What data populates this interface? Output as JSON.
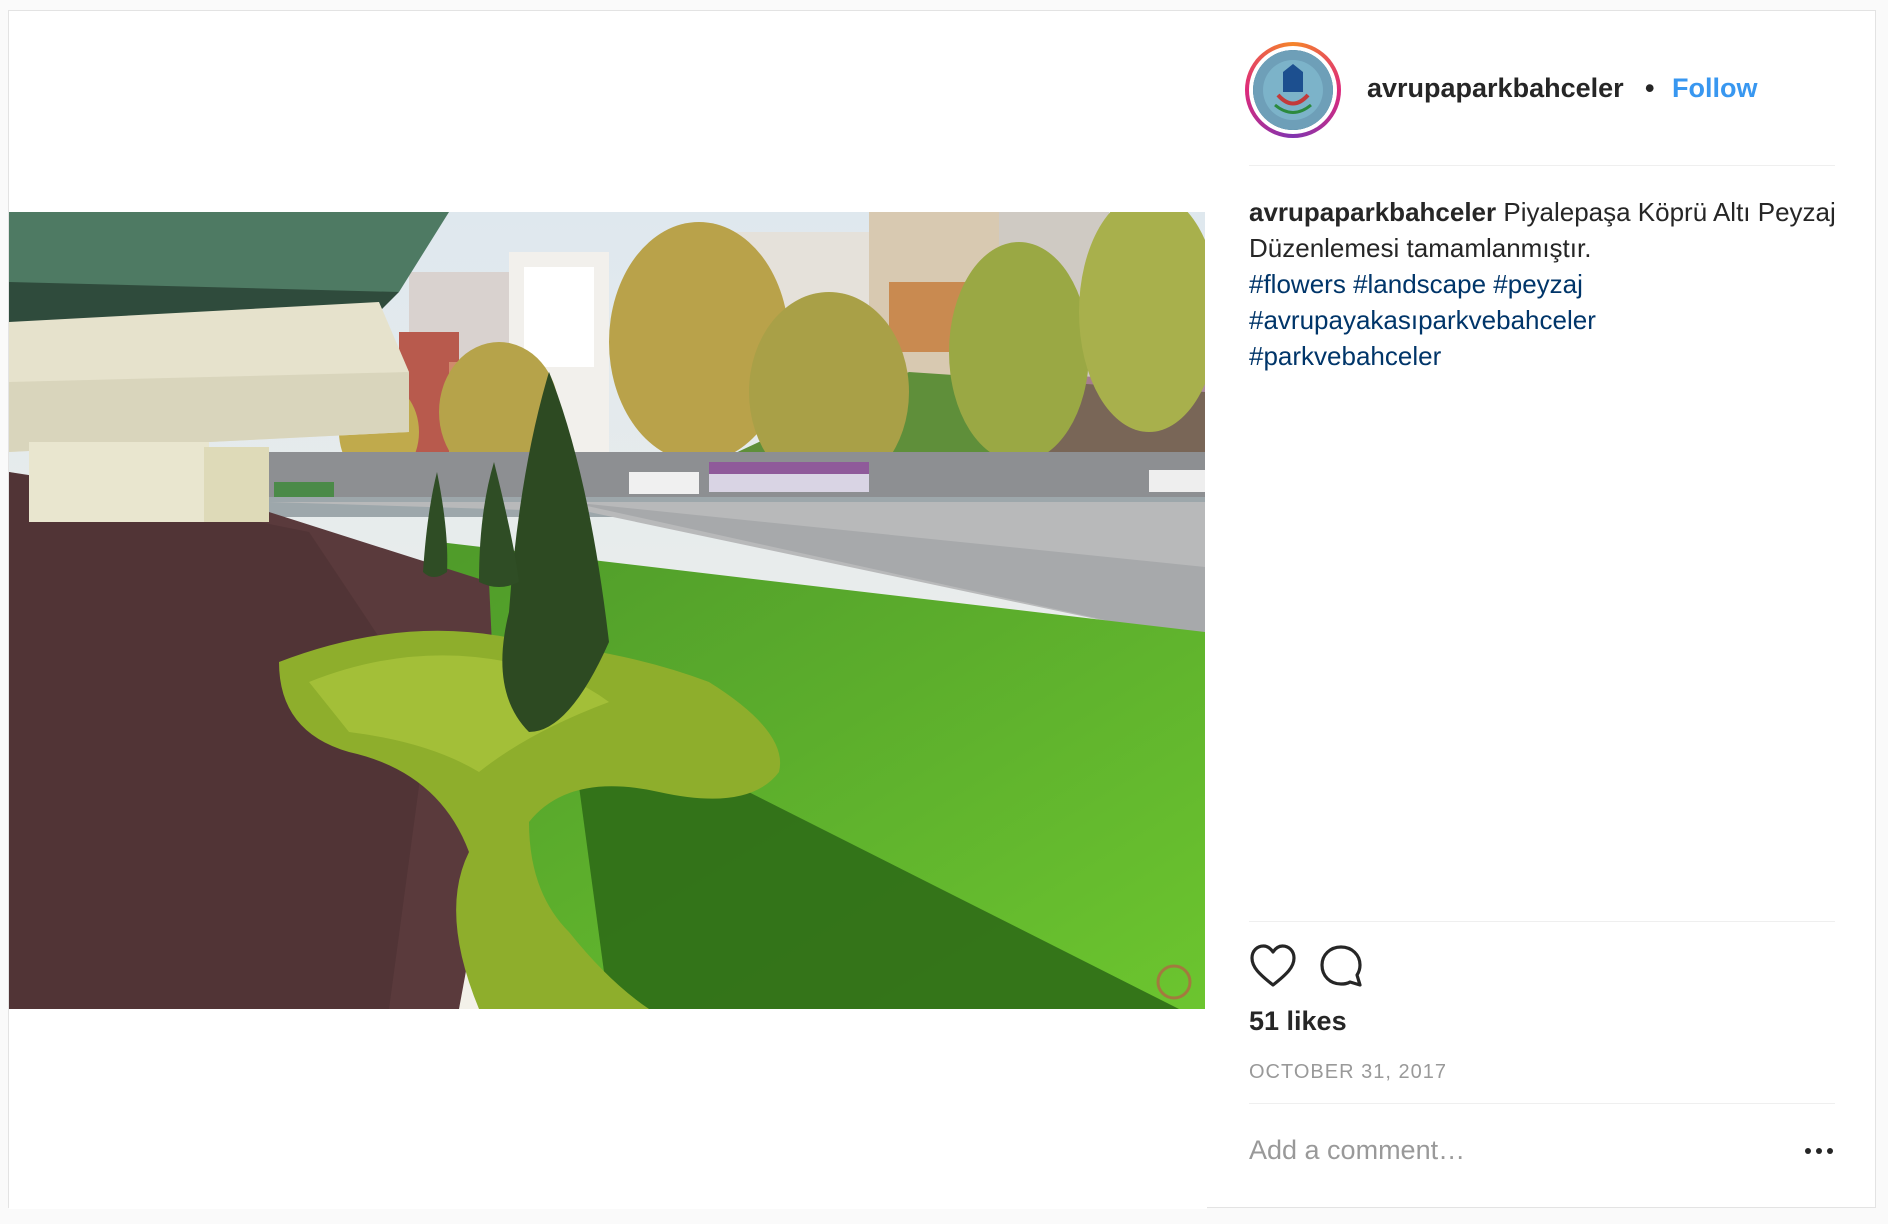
{
  "post": {
    "username": "avrupaparkbahceler",
    "separator": "•",
    "follow_label": "Follow",
    "caption_user": "avrupaparkbahceler",
    "caption_text": "Piyalepaşa Köprü Altı Peyzaj Düzenlemesi tamamlanmıştır.",
    "hashtags": [
      "#flowers",
      "#landscape",
      "#peyzaj",
      "#avrupayakasıparkvebahceler",
      "#parkvebahceler"
    ],
    "likes": "51 likes",
    "date": "OCTOBER 31, 2017",
    "comment_placeholder": "Add a comment…"
  },
  "icons": {
    "like": "heart-icon",
    "comment": "comment-bubble-icon",
    "more": "more-options-icon"
  },
  "colors": {
    "follow": "#3897f0",
    "hashtag": "#003569",
    "meta": "#999999"
  }
}
